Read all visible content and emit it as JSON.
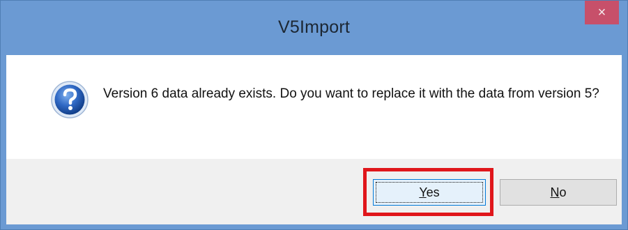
{
  "window": {
    "title": "V5Import",
    "close_glyph": "×"
  },
  "dialog": {
    "icon": "question-icon",
    "message": "Version 6 data already exists. Do you want to replace it with the data from version 5?"
  },
  "buttons": {
    "yes": {
      "mnemonic": "Y",
      "rest": "es"
    },
    "no": {
      "mnemonic": "N",
      "rest": "o"
    }
  },
  "colors": {
    "titlebar": "#6b9ad3",
    "close_button": "#c7506a",
    "highlight": "#e0161b",
    "footer": "#f0f0f0"
  }
}
